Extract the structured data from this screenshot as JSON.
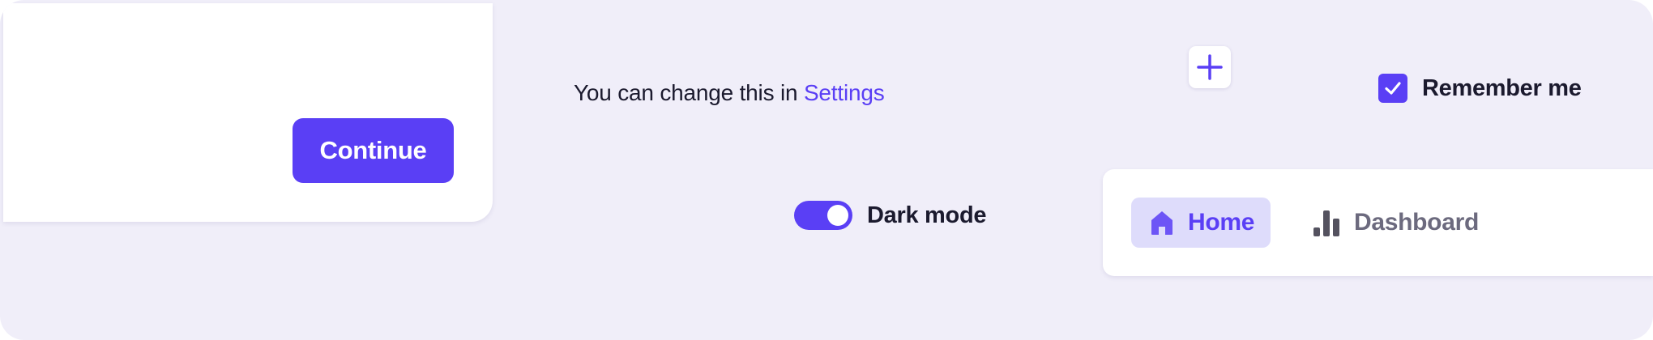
{
  "dialog": {
    "continue_label": "Continue"
  },
  "hint": {
    "prefix": "You can change this in",
    "link_label": "Settings"
  },
  "add_button": {
    "icon": "plus-icon"
  },
  "remember_me": {
    "label": "Remember me",
    "checked": true,
    "icon": "check-icon"
  },
  "dark_mode": {
    "label": "Dark mode",
    "enabled": true
  },
  "nav": {
    "items": [
      {
        "label": "Home",
        "icon": "home-icon",
        "active": true
      },
      {
        "label": "Dashboard",
        "icon": "bar-chart-icon",
        "active": false
      }
    ]
  },
  "colors": {
    "accent": "#5a3ff5",
    "background": "#f0eef9",
    "active_nav_bg": "#dedcfb",
    "text": "#1b1a2e",
    "muted_text": "#6c6a7e"
  }
}
